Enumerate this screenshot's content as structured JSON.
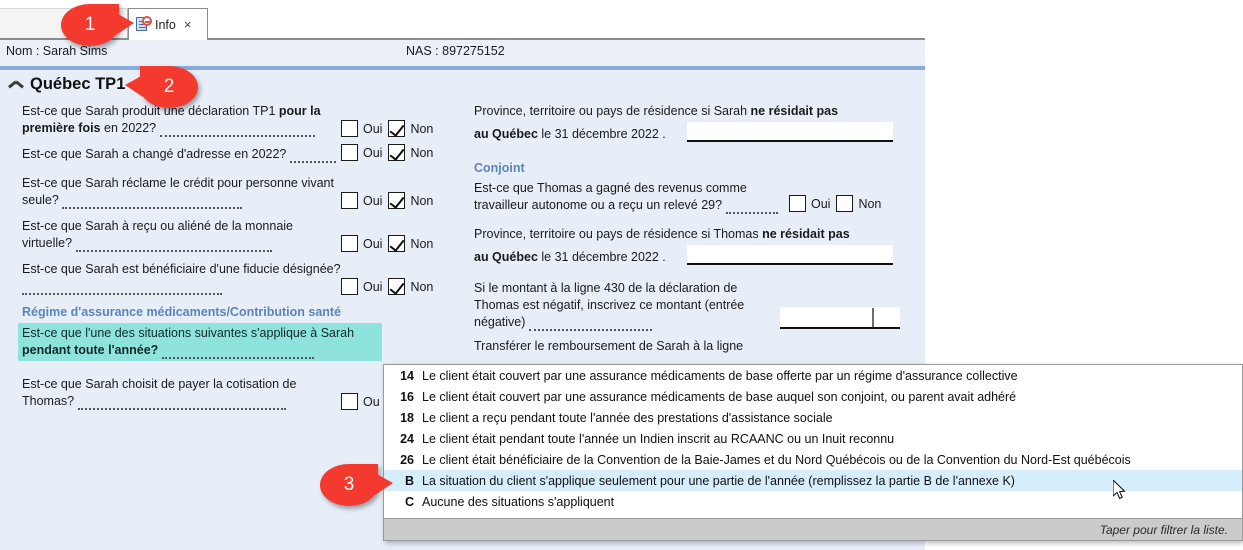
{
  "tab": {
    "label": "Info",
    "close_label": "×",
    "icon": "document-blocked-icon"
  },
  "identity": {
    "name_label": "Nom : Sarah Sims",
    "sin_label": "NAS : 897275152"
  },
  "section": {
    "title": "Québec TP1",
    "collapse_icon": "chevron-up-icon"
  },
  "left_column": {
    "questions": [
      {
        "text_part1": "Est-ce que Sarah produit une déclaration TP1 ",
        "bold": "pour la première fois",
        "text_part2": " en 2022?",
        "yes_label": "Oui",
        "no_label": "Non",
        "yes_checked": false,
        "no_checked": true
      },
      {
        "text_part1": "Est-ce que Sarah a changé d'adresse en 2022?",
        "bold": "",
        "text_part2": "",
        "yes_label": "Oui",
        "no_label": "Non",
        "yes_checked": false,
        "no_checked": true
      },
      {
        "text_part1": "Est-ce que Sarah réclame le crédit pour personne vivant seule?",
        "bold": "",
        "text_part2": "",
        "yes_label": "Oui",
        "no_label": "Non",
        "yes_checked": false,
        "no_checked": true
      },
      {
        "text_part1": "Est-ce que Sarah à reçu ou aliéné de la monnaie virtuelle?",
        "bold": "",
        "text_part2": "",
        "yes_label": "Oui",
        "no_label": "Non",
        "yes_checked": false,
        "no_checked": true
      },
      {
        "text_part1": "Est-ce que Sarah est bénéficiaire d'une fiducie désignée?",
        "bold": "",
        "text_part2": "",
        "yes_label": "Oui",
        "no_label": "Non",
        "yes_checked": false,
        "no_checked": true
      }
    ],
    "drug_plan_heading": "Régime d'assurance médicaments/Contribution santé",
    "highlighted_question": {
      "text_part1": "Est-ce que l'une des situations suivantes s'applique à Sarah ",
      "bold": "pendant toute l'année?"
    },
    "last_question": {
      "text": "Est-ce que Sarah choisit de payer la cotisation de Thomas?",
      "yes_label": "Ou",
      "yes_checked": false
    }
  },
  "right_column": {
    "residence_sarah": {
      "line1_part1": "Province, territoire ou pays de résidence si Sarah ",
      "line1_bold": "ne résidait pas",
      "line2_bold": "au Québec",
      "line2_rest": " le 31 décembre 2022  .",
      "value": ""
    },
    "spouse_heading": "Conjoint",
    "spouse_income": {
      "text": "Est-ce que Thomas a gagné des revenus comme travailleur autonome ou a reçu un relevé 29?",
      "yes_label": "Oui",
      "no_label": "Non",
      "yes_checked": false,
      "no_checked": false
    },
    "residence_thomas": {
      "line1_part1": "Province, territoire ou pays de résidence si Thomas ",
      "line1_bold": "ne résidait pas",
      "line2_bold": "au Québec",
      "line2_rest": " le 31 décembre 2022  .",
      "value": ""
    },
    "negative_amount": {
      "text": "Si le montant à la ligne 430 de la déclaration de Thomas est négatif, inscrivez ce montant (entrée négative)",
      "value": ""
    },
    "transfer_text": "Transférer le remboursement de Sarah à la ligne"
  },
  "dropdown": {
    "items": [
      {
        "code": "14",
        "label": "Le client était couvert par une assurance médicaments de base offerte par un régime d'assurance collective",
        "selected": false
      },
      {
        "code": "16",
        "label": "Le client était couvert par une assurance médicaments de base auquel son conjoint, ou parent avait adhéré",
        "selected": false
      },
      {
        "code": "18",
        "label": "Le client a reçu pendant toute l'année des prestations d'assistance sociale",
        "selected": false
      },
      {
        "code": "24",
        "label": "Le client était pendant toute l'année un Indien inscrit au RCAANC ou un Inuit reconnu",
        "selected": false
      },
      {
        "code": "26",
        "label": "Le client était bénéficiaire de la Convention de la Baie-James et du Nord Québécois ou de la Convention du Nord-Est québécois",
        "selected": false
      },
      {
        "code": "B",
        "label": "La situation du client s'applique seulement pour une partie de l'année (remplissez la partie B de l'annexe K)",
        "selected": true
      },
      {
        "code": "C",
        "label": "Aucune des situations s'appliquent",
        "selected": false
      }
    ],
    "footer": "Taper pour filtrer la liste."
  },
  "markers": [
    {
      "number": "1"
    },
    {
      "number": "2"
    },
    {
      "number": "3"
    }
  ],
  "colors": {
    "accent_blue": "#5a85bb",
    "highlight_teal": "#7fe0d8",
    "marker_red": "#f4392f",
    "selection_blue": "#d6eefb"
  }
}
